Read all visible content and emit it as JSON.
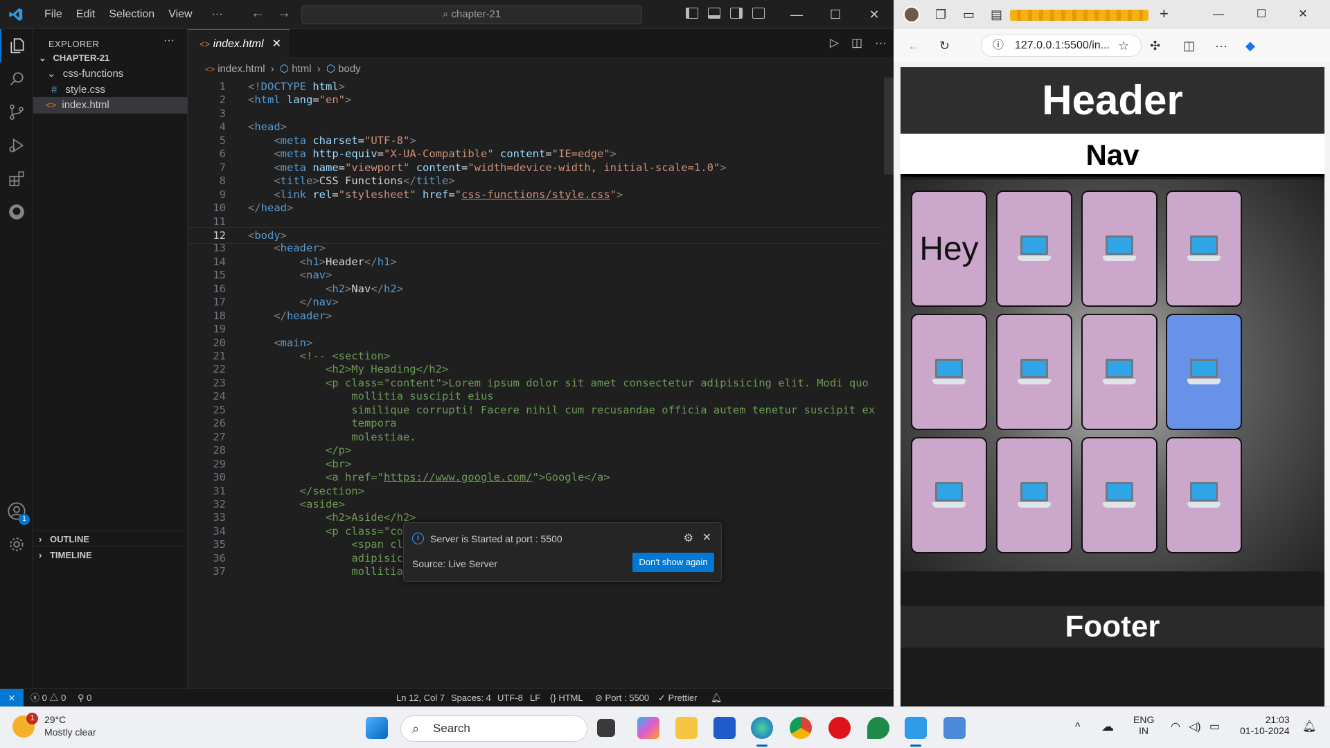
{
  "vscode": {
    "menu": [
      "File",
      "Edit",
      "Selection",
      "View",
      "···"
    ],
    "search_text": "chapter-21",
    "explorer_label": "EXPLORER",
    "folder": "CHAPTER-21",
    "subfolder": "css-functions",
    "file_css": "style.css",
    "file_html": "index.html",
    "outline": "OUTLINE",
    "timeline": "TIMELINE",
    "tab_label": "index.html",
    "breadcrumb": [
      "index.html",
      "html",
      "body"
    ],
    "account_badge": "1",
    "code_lines": [
      {
        "n": "1",
        "html": "<span class='t-br'>&lt;!</span><span class='t-tag'>DOCTYPE</span> <span class='t-attr'>html</span><span class='t-br'>&gt;</span>"
      },
      {
        "n": "2",
        "html": "<span class='t-br'>&lt;</span><span class='t-tag'>html</span> <span class='t-attr'>lang</span><span class='t-txt'>=</span><span class='t-str'>\"en\"</span><span class='t-br'>&gt;</span>"
      },
      {
        "n": "3",
        "html": ""
      },
      {
        "n": "4",
        "html": "<span class='t-br'>&lt;</span><span class='t-tag'>head</span><span class='t-br'>&gt;</span>"
      },
      {
        "n": "5",
        "html": "    <span class='t-br'>&lt;</span><span class='t-tag'>meta</span> <span class='t-attr'>charset</span><span class='t-txt'>=</span><span class='t-str'>\"UTF-8\"</span><span class='t-br'>&gt;</span>"
      },
      {
        "n": "6",
        "html": "    <span class='t-br'>&lt;</span><span class='t-tag'>meta</span> <span class='t-attr'>http-equiv</span><span class='t-txt'>=</span><span class='t-str'>\"X-UA-Compatible\"</span> <span class='t-attr'>content</span><span class='t-txt'>=</span><span class='t-str'>\"IE=edge\"</span><span class='t-br'>&gt;</span>"
      },
      {
        "n": "7",
        "html": "    <span class='t-br'>&lt;</span><span class='t-tag'>meta</span> <span class='t-attr'>name</span><span class='t-txt'>=</span><span class='t-str'>\"viewport\"</span> <span class='t-attr'>content</span><span class='t-txt'>=</span><span class='t-str'>\"width=device-width, initial-scale=1.0\"</span><span class='t-br'>&gt;</span>"
      },
      {
        "n": "8",
        "html": "    <span class='t-br'>&lt;</span><span class='t-tag'>title</span><span class='t-br'>&gt;</span><span class='t-txt'>CSS Functions</span><span class='t-br'>&lt;/</span><span class='t-tag'>title</span><span class='t-br'>&gt;</span>"
      },
      {
        "n": "9",
        "html": "    <span class='t-br'>&lt;</span><span class='t-tag'>link</span> <span class='t-attr'>rel</span><span class='t-txt'>=</span><span class='t-str'>\"stylesheet\"</span> <span class='t-attr'>href</span><span class='t-txt'>=</span><span class='t-str'>\"</span><span class='t-link'>css-functions/style.css</span><span class='t-str'>\"</span><span class='t-br'>&gt;</span>"
      },
      {
        "n": "10",
        "html": "<span class='t-br'>&lt;/</span><span class='t-tag'>head</span><span class='t-br'>&gt;</span>"
      },
      {
        "n": "11",
        "html": ""
      },
      {
        "n": "12",
        "html": "<span class='t-br'>&lt;</span><span class='t-tag'>body</span><span class='t-br'>&gt;</span>"
      },
      {
        "n": "13",
        "html": "    <span class='t-br'>&lt;</span><span class='t-tag'>header</span><span class='t-br'>&gt;</span>"
      },
      {
        "n": "14",
        "html": "        <span class='t-br'>&lt;</span><span class='t-tag'>h1</span><span class='t-br'>&gt;</span><span class='t-txt'>Header</span><span class='t-br'>&lt;/</span><span class='t-tag'>h1</span><span class='t-br'>&gt;</span>"
      },
      {
        "n": "15",
        "html": "        <span class='t-br'>&lt;</span><span class='t-tag'>nav</span><span class='t-br'>&gt;</span>"
      },
      {
        "n": "16",
        "html": "            <span class='t-br'>&lt;</span><span class='t-tag'>h2</span><span class='t-br'>&gt;</span><span class='t-txt'>Nav</span><span class='t-br'>&lt;/</span><span class='t-tag'>h2</span><span class='t-br'>&gt;</span>"
      },
      {
        "n": "17",
        "html": "        <span class='t-br'>&lt;/</span><span class='t-tag'>nav</span><span class='t-br'>&gt;</span>"
      },
      {
        "n": "18",
        "html": "    <span class='t-br'>&lt;/</span><span class='t-tag'>header</span><span class='t-br'>&gt;</span>"
      },
      {
        "n": "19",
        "html": ""
      },
      {
        "n": "20",
        "html": "    <span class='t-br'>&lt;</span><span class='t-tag'>main</span><span class='t-br'>&gt;</span>"
      },
      {
        "n": "21",
        "html": "        <span class='t-cm'>&lt;!-- &lt;section&gt;</span>"
      },
      {
        "n": "22",
        "html": "            <span class='t-cm'>&lt;h2&gt;My Heading&lt;/h2&gt;</span>"
      },
      {
        "n": "23",
        "html": "            <span class='t-cm'>&lt;p class=\"content\"&gt;Lorem ipsum dolor sit amet consectetur adipisicing elit. Modi quo</span>"
      },
      {
        "n": "24",
        "html": "                <span class='t-cm'>mollitia suscipit eius</span>"
      },
      {
        "n": "25",
        "html": "                <span class='t-cm'>similique corrupti! Facere nihil cum recusandae officia autem tenetur suscipit ex</span>"
      },
      {
        "n": "26",
        "html": "                <span class='t-cm'>tempora</span>"
      },
      {
        "n": "27",
        "html": "                <span class='t-cm'>molestiae.</span>"
      },
      {
        "n": "28",
        "html": "            <span class='t-cm'>&lt;/p&gt;</span>"
      },
      {
        "n": "29",
        "html": "            <span class='t-cm'>&lt;br&gt;</span>"
      },
      {
        "n": "30",
        "html": "            <span class='t-cm'>&lt;a href=\"<u>https://www.google.com/</u>\"&gt;Google&lt;/a&gt;</span>"
      },
      {
        "n": "31",
        "html": "        <span class='t-cm'>&lt;/section&gt;</span>"
      },
      {
        "n": "32",
        "html": "        <span class='t-cm'>&lt;aside&gt;</span>"
      },
      {
        "n": "33",
        "html": "            <span class='t-cm'>&lt;h2&gt;Aside&lt;/h2&gt;</span>"
      },
      {
        "n": "34",
        "html": "            <span class='t-cm'>&lt;p class=\"content\"&gt;</span>"
      },
      {
        "n": "35",
        "html": "                <span class='t-cm'>&lt;span class=\"tooltip\"</span>"
      },
      {
        "n": "36",
        "html": "                <span class='t-cm'>adipisicing elit. Mod</span>"
      },
      {
        "n": "37",
        "html": "                <span class='t-cm'>mollitia suscipit eius</span>"
      }
    ],
    "notification": {
      "message": "Server is Started at port : 5500",
      "source": "Source: Live Server",
      "button": "Don't show again"
    },
    "status": {
      "errors": "0",
      "warnings": "0",
      "ports": "0",
      "position": "Ln 12, Col 7",
      "spaces": "Spaces: 4",
      "encoding": "UTF-8",
      "eol": "LF",
      "language": "HTML",
      "port": "Port : 5500",
      "prettier": "Prettier"
    }
  },
  "browser": {
    "url": "127.0.0.1:5500/in...",
    "page": {
      "header": "Header",
      "nav": "Nav",
      "card_text": "Hey",
      "footer": "Footer"
    }
  },
  "taskbar": {
    "temperature": "29°C",
    "condition": "Mostly clear",
    "weather_alert": "1",
    "search": "Search",
    "lang1": "ENG",
    "lang2": "IN",
    "time": "21:03",
    "date": "01-10-2024"
  }
}
